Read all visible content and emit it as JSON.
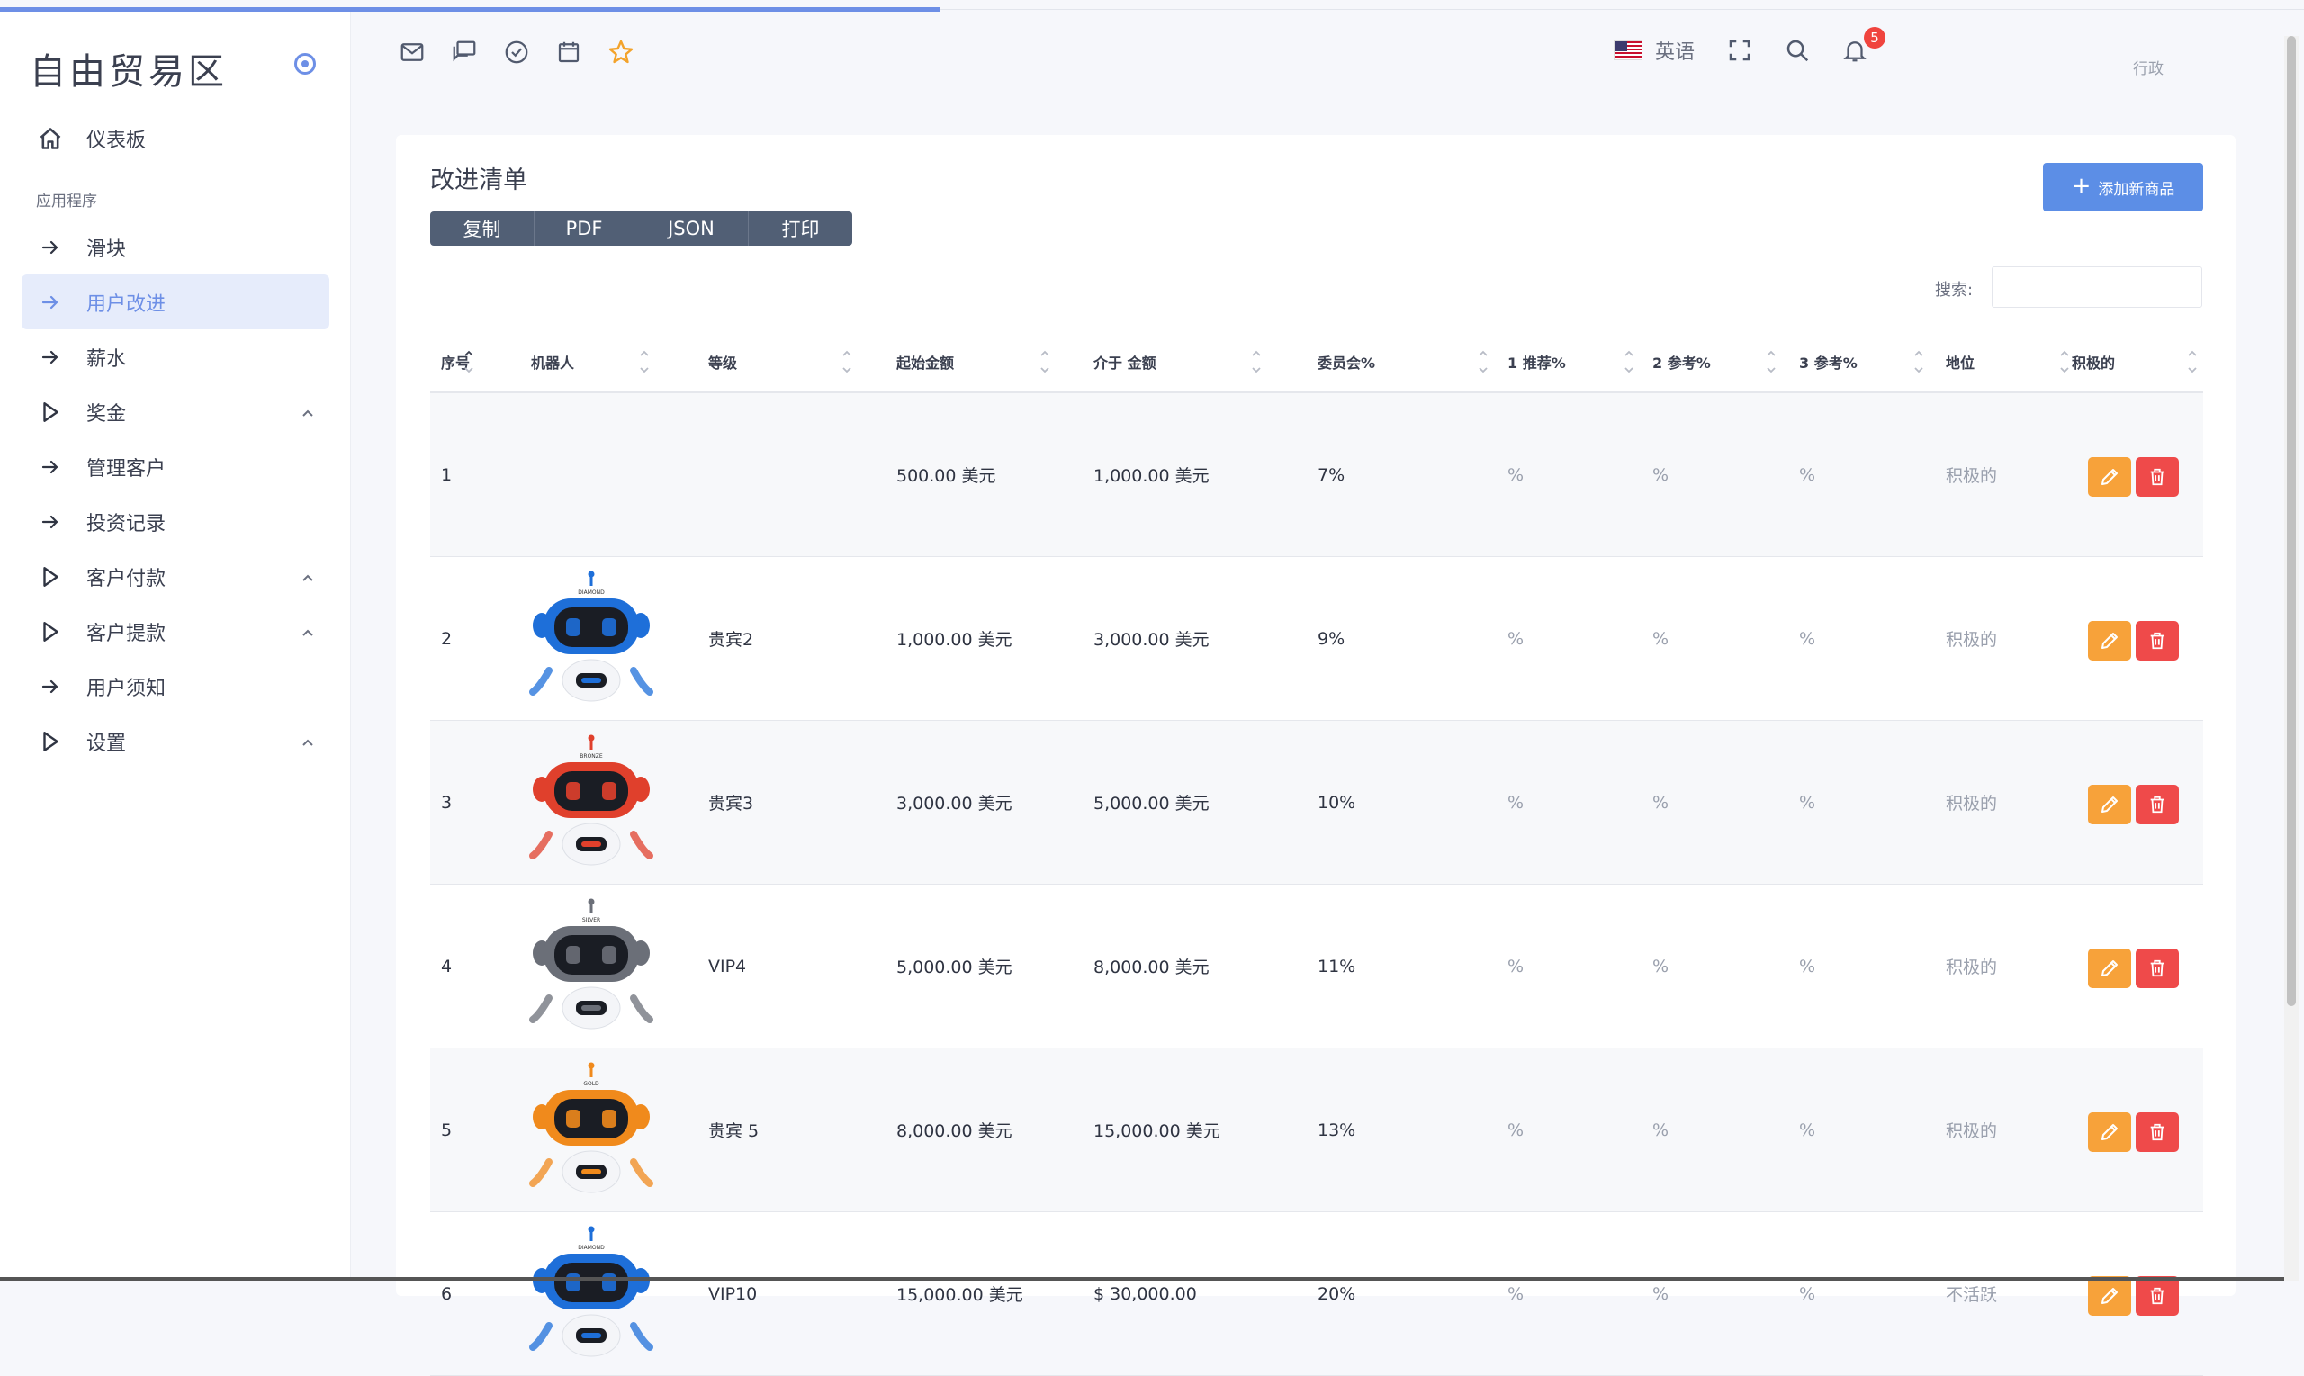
{
  "brand": {
    "name": "自由贸易区"
  },
  "nav": {
    "dashboard": "仪表板",
    "section": "应用程序",
    "items": [
      {
        "label": "滑块",
        "icon": "arrow-right-icon",
        "expandable": false,
        "active": false
      },
      {
        "label": "用户改进",
        "icon": "arrow-right-icon",
        "expandable": false,
        "active": true
      },
      {
        "label": "薪水",
        "icon": "arrow-right-icon",
        "expandable": false,
        "active": false
      },
      {
        "label": "奖金",
        "icon": "play-icon",
        "expandable": true,
        "active": false
      },
      {
        "label": "管理客户",
        "icon": "arrow-right-icon",
        "expandable": false,
        "active": false
      },
      {
        "label": "投资记录",
        "icon": "arrow-right-icon",
        "expandable": false,
        "active": false
      },
      {
        "label": "客户付款",
        "icon": "play-icon",
        "expandable": true,
        "active": false
      },
      {
        "label": "客户提款",
        "icon": "play-icon",
        "expandable": true,
        "active": false
      },
      {
        "label": "用户须知",
        "icon": "arrow-right-icon",
        "expandable": false,
        "active": false
      },
      {
        "label": "设置",
        "icon": "play-icon",
        "expandable": true,
        "active": false
      }
    ]
  },
  "header": {
    "icons": [
      "mail-icon",
      "chat-icon",
      "check-circle-icon",
      "calendar-icon",
      "star-icon"
    ],
    "language": "英语",
    "notification_count": "5",
    "user_role": "行政"
  },
  "card": {
    "title": "改进清单",
    "export_buttons": [
      "复制",
      "PDF",
      "JSON",
      "打印"
    ],
    "add_button": "添加新商品",
    "search_label": "搜索:",
    "search_value": ""
  },
  "table": {
    "headers": [
      "序号",
      "机器人",
      "等级",
      "起始金额",
      "介于 金额",
      "委员会%",
      "1 推荐%",
      "2 参考%",
      "3 参考%",
      "地位",
      "积极的"
    ],
    "rows": [
      {
        "no": "1",
        "robot": "",
        "robot_label": "",
        "level": "",
        "start": "500.00 美元",
        "between": "1,000.00 美元",
        "commission": "7%",
        "ref1": "%",
        "ref2": "%",
        "ref3": "%",
        "status": "积极的"
      },
      {
        "no": "2",
        "robot": "blue",
        "robot_label": "DIAMOND",
        "level": "贵宾2",
        "start": "1,000.00 美元",
        "between": "3,000.00 美元",
        "commission": "9%",
        "ref1": "%",
        "ref2": "%",
        "ref3": "%",
        "status": "积极的"
      },
      {
        "no": "3",
        "robot": "red",
        "robot_label": "BRONZE",
        "level": "贵宾3",
        "start": "3,000.00 美元",
        "between": "5,000.00 美元",
        "commission": "10%",
        "ref1": "%",
        "ref2": "%",
        "ref3": "%",
        "status": "积极的"
      },
      {
        "no": "4",
        "robot": "gray",
        "robot_label": "SILVER",
        "level": "VIP4",
        "start": "5,000.00 美元",
        "between": "8,000.00 美元",
        "commission": "11%",
        "ref1": "%",
        "ref2": "%",
        "ref3": "%",
        "status": "积极的"
      },
      {
        "no": "5",
        "robot": "orange",
        "robot_label": "GOLD",
        "level": "贵宾 5",
        "start": "8,000.00 美元",
        "between": "15,000.00 美元",
        "commission": "13%",
        "ref1": "%",
        "ref2": "%",
        "ref3": "%",
        "status": "积极的"
      },
      {
        "no": "6",
        "robot": "blue",
        "robot_label": "DIAMOND",
        "level": "VIP10",
        "start": "15,000.00 美元",
        "between": "$ 30,000.00",
        "commission": "20%",
        "ref1": "%",
        "ref2": "%",
        "ref3": "%",
        "status": "不活跃"
      }
    ]
  },
  "colors": {
    "accent": "#6d8fe6",
    "add_button": "#5c8ee6",
    "export_button": "#515f75",
    "edit": "#f7a23a",
    "delete": "#ef4a4a",
    "badge": "#f0443e",
    "robot_blue": "#1e6fd9",
    "robot_red": "#e0402c",
    "robot_gray": "#6b6f78",
    "robot_orange": "#f08a1c"
  }
}
